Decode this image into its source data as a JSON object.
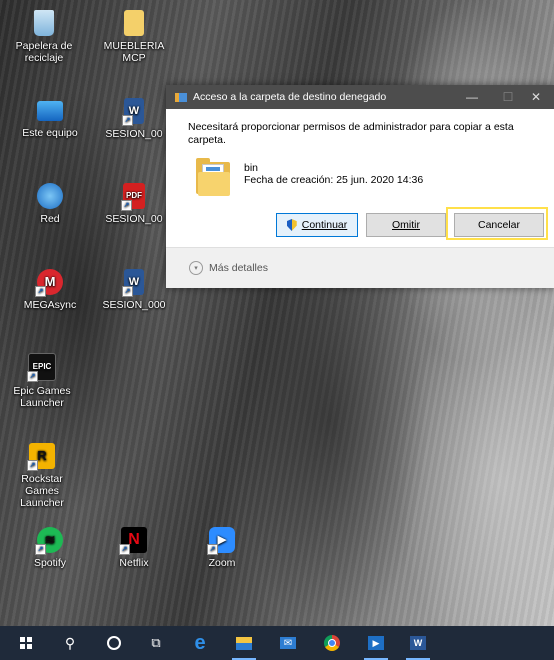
{
  "desktop": {
    "icons": [
      {
        "label": "Papelera de reciclaje",
        "icon": "recycle-bin-icon"
      },
      {
        "label": "MUEBLERIA MCP",
        "icon": "folder-icon"
      },
      {
        "label": "Este equipo",
        "icon": "computer-icon"
      },
      {
        "label": "SESION_00",
        "icon": "word-document-icon"
      },
      {
        "label": "Red",
        "icon": "network-icon"
      },
      {
        "label": "SESION_00",
        "icon": "pdf-document-icon"
      },
      {
        "label": "MEGAsync",
        "icon": "megasync-icon"
      },
      {
        "label": "SESION_000",
        "icon": "word-document-icon"
      },
      {
        "label": "Epic Games Launcher",
        "icon": "epic-games-icon"
      },
      {
        "label": "Rockstar Games Launcher",
        "icon": "rockstar-icon"
      },
      {
        "label": "Spotify",
        "icon": "spotify-icon"
      },
      {
        "label": "Netflix",
        "icon": "netflix-icon"
      },
      {
        "label": "Zoom",
        "icon": "zoom-icon"
      }
    ]
  },
  "dialog": {
    "title": "Acceso a la carpeta de destino denegado",
    "message": "Necesitará proporcionar permisos de administrador para copiar a esta carpeta.",
    "file_name": "bin",
    "file_date": "Fecha de creación: 25 jun. 2020 14:36",
    "buttons": {
      "continue_label": "Continuar",
      "skip_label": "Omitir",
      "cancel_label": "Cancelar"
    },
    "more_details_label": "Más detalles",
    "controls": {
      "minimize": "—",
      "maximize": "☐",
      "close": "✕"
    }
  },
  "taskbar": {
    "items": [
      "start-icon",
      "search-icon",
      "cortana-icon",
      "task-view-icon",
      "edge-icon",
      "file-explorer-icon",
      "mail-icon",
      "chrome-icon",
      "movies-icon",
      "word-icon"
    ]
  },
  "colors": {
    "taskbar_bg": "#1f2a3a",
    "titlebar_bg": "#4d4d4d",
    "accent": "#0078d7",
    "highlight": "#ffe04a"
  }
}
